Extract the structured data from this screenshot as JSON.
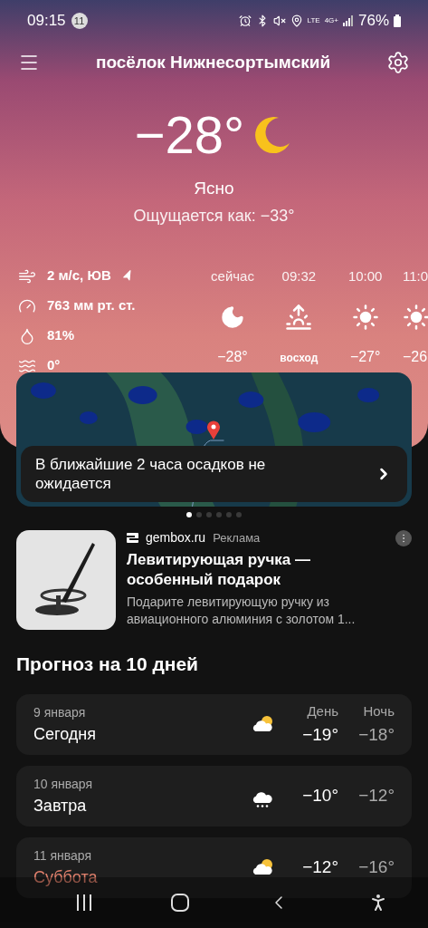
{
  "status_bar": {
    "time": "09:15",
    "notification_count": "11",
    "network_1": "LTE",
    "network_2": "4G+",
    "battery": "76%"
  },
  "header": {
    "title": "посёлок Нижнесортымский"
  },
  "current": {
    "temperature": "−28°",
    "condition": "Ясно",
    "feels_like": "Ощущается как: −33°"
  },
  "details": [
    {
      "kind": "wind",
      "text": "2 м/с, ЮВ"
    },
    {
      "kind": "pressure",
      "text": "763 мм рт. ст."
    },
    {
      "kind": "humidity",
      "text": "81%"
    },
    {
      "kind": "water",
      "text": "0°"
    }
  ],
  "hourly": [
    {
      "time": "сейчас",
      "kind": "moon",
      "value": "−28°"
    },
    {
      "time": "09:32",
      "kind": "sunrise",
      "value": "восход"
    },
    {
      "time": "10:00",
      "kind": "sun",
      "value": "−27°"
    },
    {
      "time": "11:0",
      "kind": "sun",
      "value": "−26"
    }
  ],
  "nowcast": {
    "text": "В ближайшие 2 часа осадков не ожидается"
  },
  "map_pages": [
    {
      "selected": true
    },
    {
      "selected": false
    },
    {
      "selected": false
    },
    {
      "selected": false
    },
    {
      "selected": false
    },
    {
      "selected": false
    }
  ],
  "ad": {
    "domain": "gembox.ru",
    "label": "Реклама",
    "title": "Левитирующая ручка — особенный подарок",
    "text": "Подарите левитирующую ручку из авиационного алюминия с золотом 1..."
  },
  "forecast": {
    "title": "Прогноз на 10 дней",
    "day_header": "День",
    "night_header": "Ночь",
    "days": [
      {
        "date": "9 января",
        "name": "Сегодня",
        "weekend": false,
        "kind": "partly_cloudy",
        "day": "−19°",
        "night": "−18°"
      },
      {
        "date": "10 января",
        "name": "Завтра",
        "weekend": false,
        "kind": "snow",
        "day": "−10°",
        "night": "−12°"
      },
      {
        "date": "11 января",
        "name": "Суббота",
        "weekend": true,
        "kind": "partly_cloudy",
        "day": "−12°",
        "night": "−16°"
      }
    ]
  }
}
